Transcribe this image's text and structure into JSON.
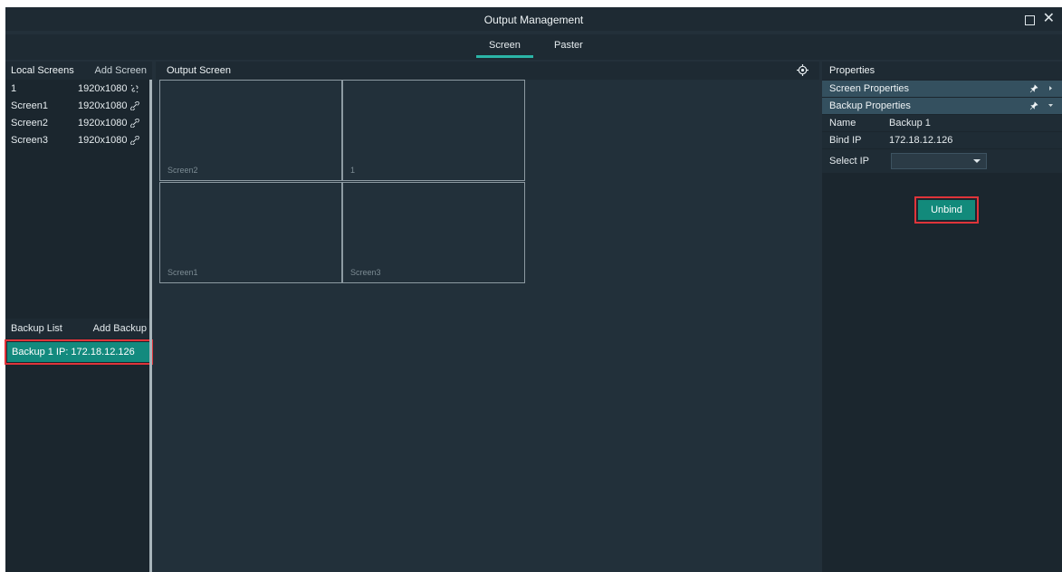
{
  "window": {
    "title": "Output Management"
  },
  "tabs": [
    {
      "label": "Screen"
    },
    {
      "label": "Paster"
    }
  ],
  "local_screens": {
    "title": "Local Screens",
    "add_label": "Add Screen",
    "items": [
      {
        "name": "1",
        "resolution": "1920x1080"
      },
      {
        "name": "Screen1",
        "resolution": "1920x1080"
      },
      {
        "name": "Screen2",
        "resolution": "1920x1080"
      },
      {
        "name": "Screen3",
        "resolution": "1920x1080"
      }
    ]
  },
  "backup_list": {
    "title": "Backup List",
    "add_label": "Add Backup",
    "items": [
      {
        "label": "Backup 1   IP: 172.18.12.126"
      }
    ]
  },
  "output_screen": {
    "title": "Output Screen",
    "cells": [
      {
        "label": "Screen2"
      },
      {
        "label": "1"
      },
      {
        "label": "Screen1"
      },
      {
        "label": "Screen3"
      }
    ]
  },
  "properties": {
    "title": "Properties",
    "screen_section": "Screen Properties",
    "backup_section": "Backup Properties",
    "name_key": "Name",
    "name_value": "Backup 1",
    "bind_ip_key": "Bind IP",
    "bind_ip_value": "172.18.12.126",
    "select_ip_key": "Select IP",
    "select_ip_value": "",
    "unbind_label": "Unbind"
  },
  "colors": {
    "accent": "#2bb5a8",
    "highlight": "#e0343a",
    "selected_row": "#138a7e"
  }
}
